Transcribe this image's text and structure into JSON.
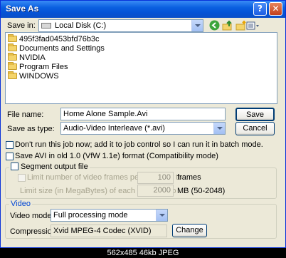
{
  "window": {
    "title": "Save As",
    "help_glyph": "?",
    "close_glyph": "✕"
  },
  "save_in": {
    "label": "Save in:",
    "value": "Local Disk (C:)"
  },
  "toolbar": {
    "icons": [
      "back-icon",
      "up-folder-icon",
      "new-folder-icon",
      "views-icon"
    ]
  },
  "files": [
    {
      "name": "495f3fad0453bfd76b3c"
    },
    {
      "name": "Documents and Settings"
    },
    {
      "name": "NVIDIA"
    },
    {
      "name": "Program Files"
    },
    {
      "name": "WINDOWS"
    }
  ],
  "file_name": {
    "label": "File name:",
    "value": "Home Alone Sample.Avi"
  },
  "save_as_type": {
    "label": "Save as type:",
    "value": "Audio-Video Interleave (*.avi)"
  },
  "buttons": {
    "save": "Save",
    "cancel": "Cancel",
    "change": "Change"
  },
  "options": {
    "dont_run": "Don't run this job now; add it to job control so I can run it in batch mode.",
    "save_old": "Save AVI in old 1.0 (VfW 1.1e) format (Compatibility mode)"
  },
  "segment": {
    "label": "Segment output file",
    "limit_frames_label": "Limit number of video frames per segment to",
    "limit_frames_value": "100",
    "limit_frames_unit": "frames",
    "limit_size_label": "Limit size (in MegaBytes) of each segment to :",
    "limit_size_value": "2000",
    "limit_size_unit": "MB (50-2048)"
  },
  "video": {
    "group_label": "Video",
    "mode_label": "Video mode :",
    "mode_value": "Full processing mode",
    "compression_label": "Compression :",
    "compression_value": "Xvid MPEG-4 Codec (XVID)"
  },
  "footer": {
    "text": "562x485 46kb JPEG"
  }
}
